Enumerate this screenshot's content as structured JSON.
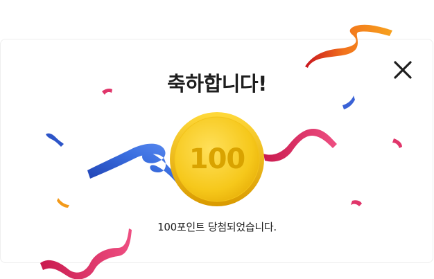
{
  "dialog": {
    "title": "축하합니다!",
    "message": "100포인트 당첨되었습니다.",
    "close_icon": "close-icon"
  },
  "coin": {
    "value": "100",
    "icon": "coin-icon"
  },
  "colors": {
    "coin_face": "#F5C518",
    "coin_edge": "#E0A800",
    "coin_text": "#D9A300",
    "ribbon_blue": "#2D55C8",
    "ribbon_pink": "#E0356A",
    "ribbon_orange": "#F08A1A",
    "ribbon_red": "#D22B2B"
  }
}
